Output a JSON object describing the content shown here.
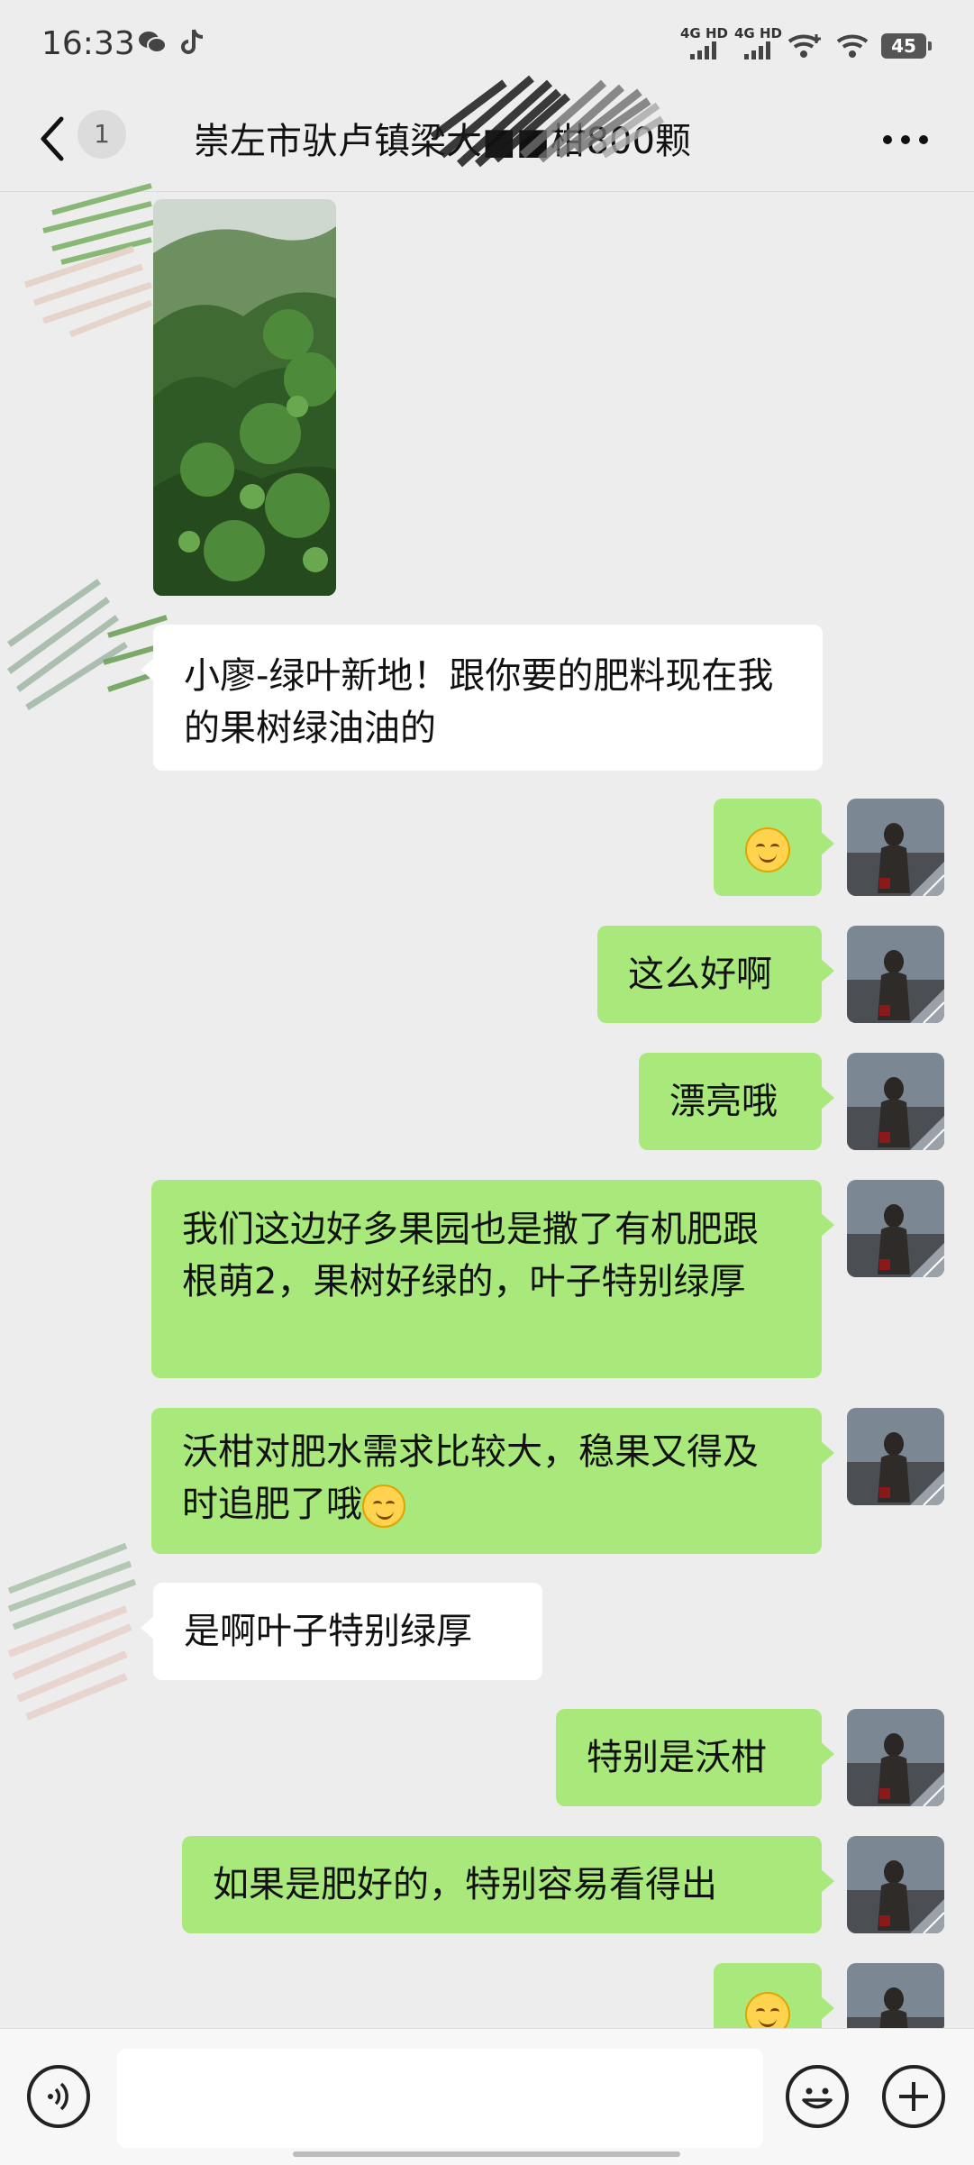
{
  "status_bar": {
    "time": "16:33",
    "battery": "45",
    "network_1": "4G HD",
    "network_2": "4G HD"
  },
  "header": {
    "title": "崇左市驮卢镇梁大■■柑800颗",
    "unread": "1"
  },
  "messages": [
    {
      "sender": "other",
      "type": "image"
    },
    {
      "sender": "other",
      "type": "text",
      "text": "小廖-绿叶新地！跟你要的肥料现在我的果树绿油油的"
    },
    {
      "sender": "me",
      "type": "emoji",
      "emoji": "smile-emoji"
    },
    {
      "sender": "me",
      "type": "text",
      "text": "这么好啊"
    },
    {
      "sender": "me",
      "type": "text",
      "text": "漂亮哦"
    },
    {
      "sender": "me",
      "type": "text",
      "text": "我们这边好多果园也是撒了有机肥跟根萌2，果树好绿的，叶子特别绿厚"
    },
    {
      "sender": "me",
      "type": "text",
      "text": "沃柑对肥水需求比较大，稳果又得及时追肥了哦"
    },
    {
      "sender": "other",
      "type": "text",
      "text": "是啊叶子特别绿厚"
    },
    {
      "sender": "me",
      "type": "text",
      "text": "特别是沃柑"
    },
    {
      "sender": "me",
      "type": "text",
      "text": "如果是肥好的，特别容易看得出"
    },
    {
      "sender": "me",
      "type": "emoji",
      "emoji": "smile-emoji"
    }
  ],
  "input": {
    "placeholder": ""
  },
  "colors": {
    "background": "#ededed",
    "outgoing_bubble": "#a9e97b",
    "incoming_bubble": "#ffffff"
  }
}
